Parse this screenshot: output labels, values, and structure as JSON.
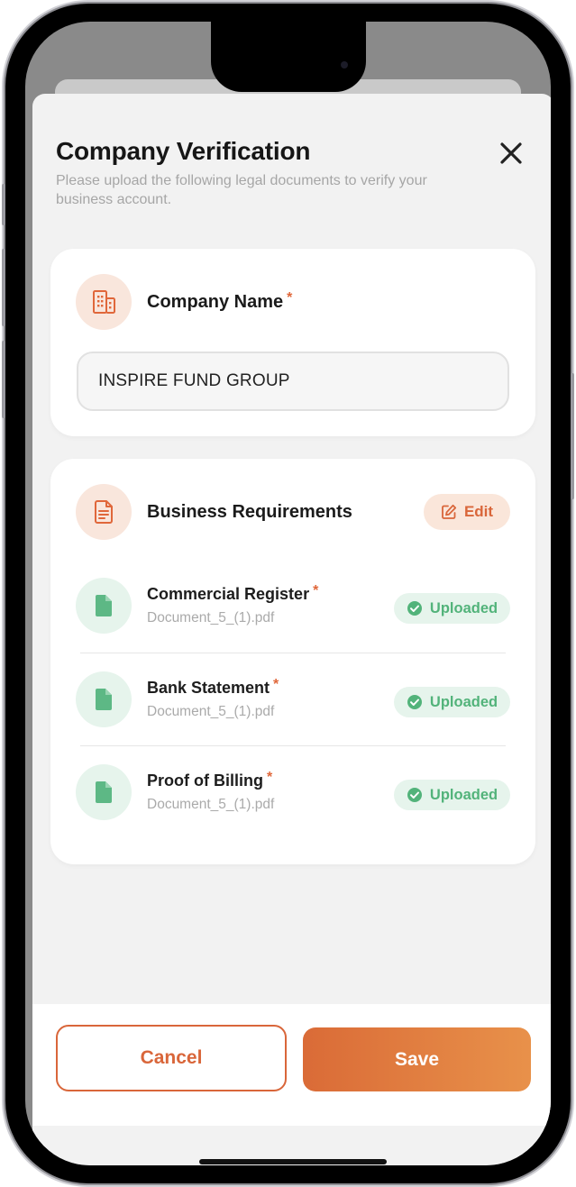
{
  "header": {
    "title": "Company Verification",
    "subtitle": "Please upload the following legal documents to verify your business account."
  },
  "company": {
    "label": "Company Name",
    "required_mark": "*",
    "value": "INSPIRE FUND GROUP"
  },
  "business": {
    "label": "Business Requirements",
    "edit_label": "Edit",
    "documents": [
      {
        "title": "Commercial Register",
        "required_mark": "*",
        "file": "Document_5_(1).pdf",
        "status": "Uploaded"
      },
      {
        "title": "Bank Statement",
        "required_mark": "*",
        "file": "Document_5_(1).pdf",
        "status": "Uploaded"
      },
      {
        "title": "Proof of Billing",
        "required_mark": "*",
        "file": "Document_5_(1).pdf",
        "status": "Uploaded"
      }
    ]
  },
  "footer": {
    "cancel_label": "Cancel",
    "save_label": "Save"
  },
  "colors": {
    "accent": "#D9663A",
    "success": "#52B37A",
    "sheet_background": "#F2F2F2"
  },
  "icons": [
    "building-icon",
    "document-icon",
    "edit-icon",
    "file-icon",
    "check-circle-icon",
    "close-icon"
  ]
}
